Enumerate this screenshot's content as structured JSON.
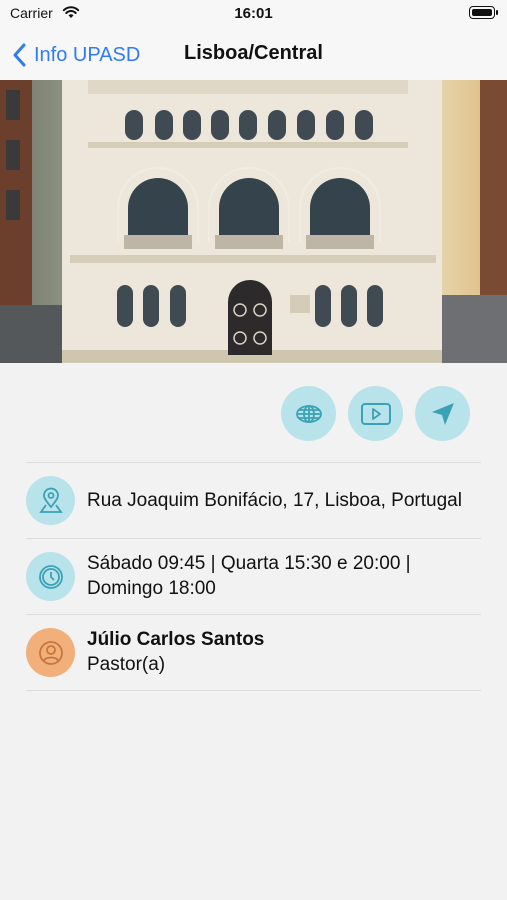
{
  "status_bar": {
    "carrier": "Carrier",
    "time": "16:01"
  },
  "nav": {
    "back_label": "Info UPASD",
    "title": "Lisboa/Central"
  },
  "hero": {
    "image": "church-facade"
  },
  "actions": [
    {
      "icon": "globe-icon"
    },
    {
      "icon": "play-icon"
    },
    {
      "icon": "navigation-arrow-icon"
    }
  ],
  "details": {
    "address": "Rua Joaquim Bonifácio, 17, Lisboa, Portugal",
    "schedule_line1": "Sábado 09:45 | Quarta 15:30 e 20:00 |",
    "schedule_line2": "Domingo 18:00",
    "pastor_name": "Júlio Carlos Santos",
    "pastor_role": "Pastor(a)"
  },
  "colors": {
    "accent": "#2f7bf6",
    "icon_bg": "#b9e3ea",
    "icon_fg": "#3aa2b6",
    "person_bg": "#f1b07b",
    "person_fg": "#c7763a"
  }
}
